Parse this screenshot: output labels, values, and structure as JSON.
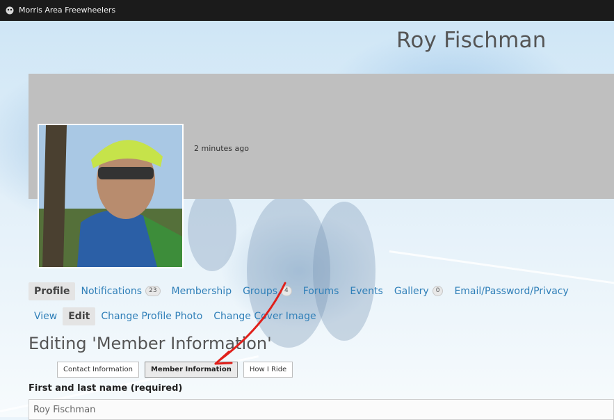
{
  "window": {
    "title": "Morris Area Freewheelers"
  },
  "profile": {
    "name": "Roy Fischman",
    "last_active": "2 minutes ago"
  },
  "nav_primary": [
    {
      "label": "Profile",
      "current": true
    },
    {
      "label": "Notifications",
      "count": "23"
    },
    {
      "label": "Membership"
    },
    {
      "label": "Groups",
      "count": "4"
    },
    {
      "label": "Forums"
    },
    {
      "label": "Events"
    },
    {
      "label": "Gallery",
      "count": "0"
    },
    {
      "label": "Email/Password/Privacy"
    }
  ],
  "nav_secondary": [
    {
      "label": "View"
    },
    {
      "label": "Edit",
      "current": true
    },
    {
      "label": "Change Profile Photo"
    },
    {
      "label": "Change Cover Image"
    }
  ],
  "edit": {
    "heading": "Editing 'Member Information'",
    "tabs": [
      {
        "label": "Contact Information"
      },
      {
        "label": "Member Information",
        "current": true
      },
      {
        "label": "How I Ride"
      }
    ],
    "field_label": "First and last name (required)",
    "field_value": "Roy Fischman"
  },
  "colors": {
    "link": "#2f7fb8",
    "annotation_arrow": "#e0201b",
    "cover": "#bfbfbf"
  }
}
